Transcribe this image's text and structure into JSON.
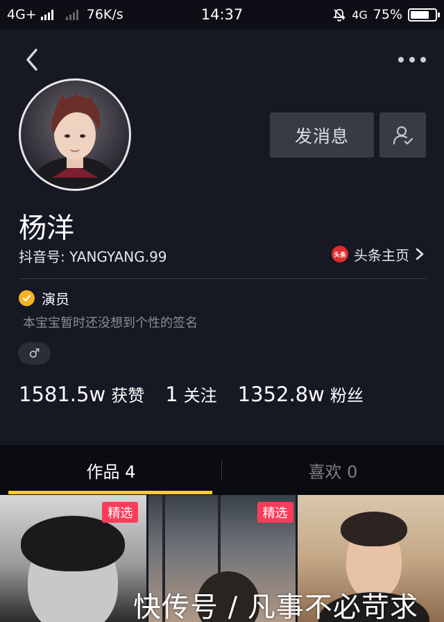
{
  "status_bar": {
    "network_left": "4G+",
    "speed": "76K/s",
    "time": "14:37",
    "network_right": "4G",
    "battery": "75%",
    "battery_level": 0.75
  },
  "header": {
    "back_icon": "chevron-left-icon",
    "more_icon": "more-horizontal-icon"
  },
  "profile": {
    "name": "杨洋",
    "douyin_id": "抖音号: YANGYANG.99",
    "toutiao_logo": "头条",
    "toutiao_link": "头条主页",
    "verification": "演员",
    "signature": "本宝宝暂时还没想到个性的签名",
    "gender_symbol": "♂"
  },
  "actions": {
    "message_button": "发消息",
    "follow_icon": "user-check-icon"
  },
  "stats": [
    {
      "value": "1581.5w",
      "label": "获赞"
    },
    {
      "value": "1",
      "label": "关注"
    },
    {
      "value": "1352.8w",
      "label": "粉丝"
    }
  ],
  "tabs": [
    {
      "label": "作品 4"
    },
    {
      "label": "喜欢 0"
    }
  ],
  "grid": [
    {
      "badge": "精选"
    },
    {
      "badge": "精选"
    },
    {
      "badge": ""
    }
  ],
  "watermark": "快传号 / 凡事不必苛求",
  "colors": {
    "background": "#161823",
    "accent": "#f9cf1d",
    "badge": "#fa3c5a",
    "verified": "#f5b324"
  }
}
